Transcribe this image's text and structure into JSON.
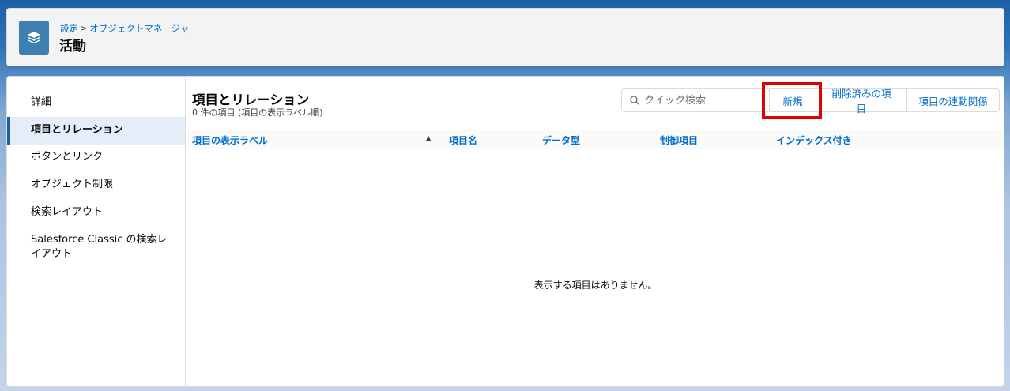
{
  "header": {
    "breadcrumb": [
      "設定",
      "オブジェクトマネージャ"
    ],
    "breadcrumb_sep": ">",
    "title": "活動",
    "icon": "layers-icon"
  },
  "sidebar": {
    "items": [
      {
        "label": "詳細",
        "active": false
      },
      {
        "label": "項目とリレーション",
        "active": true
      },
      {
        "label": "ボタンとリンク",
        "active": false
      },
      {
        "label": "オブジェクト制限",
        "active": false
      },
      {
        "label": "検索レイアウト",
        "active": false
      },
      {
        "label": "Salesforce Classic の検索レイアウト",
        "active": false
      }
    ]
  },
  "main": {
    "title": "項目とリレーション",
    "subtitle": "0 件の項目 (項目の表示ラベル順)",
    "search": {
      "placeholder": "クイック検索",
      "icon": "search-icon"
    },
    "buttons": [
      "新規",
      "削除済みの項目",
      "項目の連動関係"
    ],
    "columns": [
      "項目の表示ラベル",
      "項目名",
      "データ型",
      "制御項目",
      "インデックス付き"
    ],
    "sort_indicator": "▲",
    "empty_message": "表示する項目はありません。"
  },
  "colors": {
    "accent": "#006dcc",
    "highlight": "#e00000",
    "icon_bg": "#3f7fb0"
  }
}
